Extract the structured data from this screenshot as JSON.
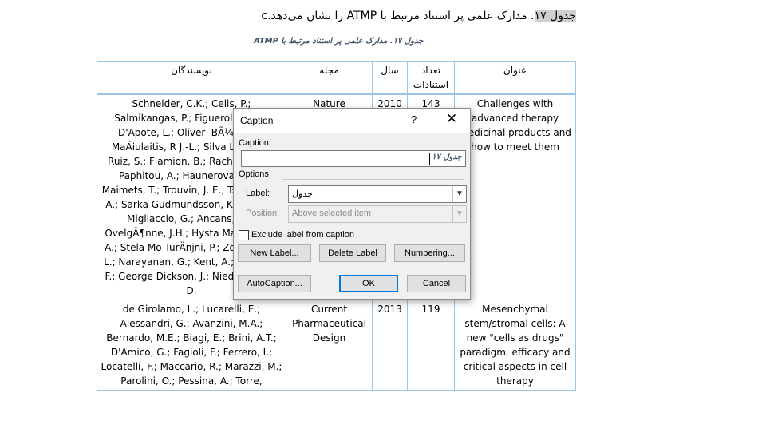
{
  "document": {
    "heading_prefix": "جدول ۱۷",
    "heading_text": ". مدارک علمی پر استناد مرتبط با ATMP را نشان می‌دهد.c",
    "caption_line": "جدول ۱۷. مدارک علمی پر استناد مرتبط با ATMP",
    "table": {
      "headers": [
        "نویسندگان",
        "مجله",
        "سال",
        "تعداد استنادات",
        "عنوان"
      ],
      "rows": [
        {
          "authors": "Schneider, C.K.; Celis, P.; Salmikangas, P.; Figuerola M.-A.; D'Apote, L.; Oliver- BÃ¼ttel, I.; MaÄiulaitis, R J.-L.; Silva Lima, B.; Ruiz, S.; Flamion, B.; Racheva Todo Paphitou, A.; Haunerova, I. M.; Maimets, T.; Trouvin, J. E.; Tsiftsoglou, A.; Sarka Gudmundsson, K.; O'Dono Migliaccio, G.; Ancans, J.; S OvelgÃ¶nne, J.H.; Hysta Mariusz Fal, A.; Stela Mo TurÄnjni, P.; Zorec, R.; Ä L.; Narayanan, G.; Kent, A.; Bignami, F.; George Dickson, J.; Niederwieser, D.",
          "journal": "Nature",
          "year": "2010",
          "citations": "143",
          "title": "Challenges with advanced therapy medicinal products and how to meet them"
        },
        {
          "authors": "de Girolamo, L.; Lucarelli, E.; Alessandri, G.; Avanzini, M.A.; Bernardo, M.E.; Biagi, E.; Brini, A.T.; D'Amico, G.; Fagioli, F.; Ferrero, I.; Locatelli, F.; Maccario, R.; Marazzi, M.; Parolini, O.; Pessina, A.; Torre,",
          "journal": "Current Pharmaceutical Design",
          "year": "2013",
          "citations": "119",
          "title": "Mesenchymal stem/stromal cells: A new \"cells as drugs\" paradigm. efficacy and critical aspects in cell therapy"
        }
      ]
    }
  },
  "dialog": {
    "title": "Caption",
    "help": "?",
    "close": "✕",
    "caption_label": "Caption:",
    "caption_value": "جدول ۱۷",
    "options_label": "Options",
    "label_label": "Label:",
    "label_value": "جدول",
    "position_label": "Position:",
    "position_value": "Above selected item",
    "exclude_label": "Exclude label from caption",
    "new_label_btn": "New Label...",
    "delete_label_btn": "Delete Label",
    "numbering_btn": "Numbering...",
    "autocaption_btn": "AutoCaption...",
    "ok_btn": "OK",
    "cancel_btn": "Cancel"
  }
}
